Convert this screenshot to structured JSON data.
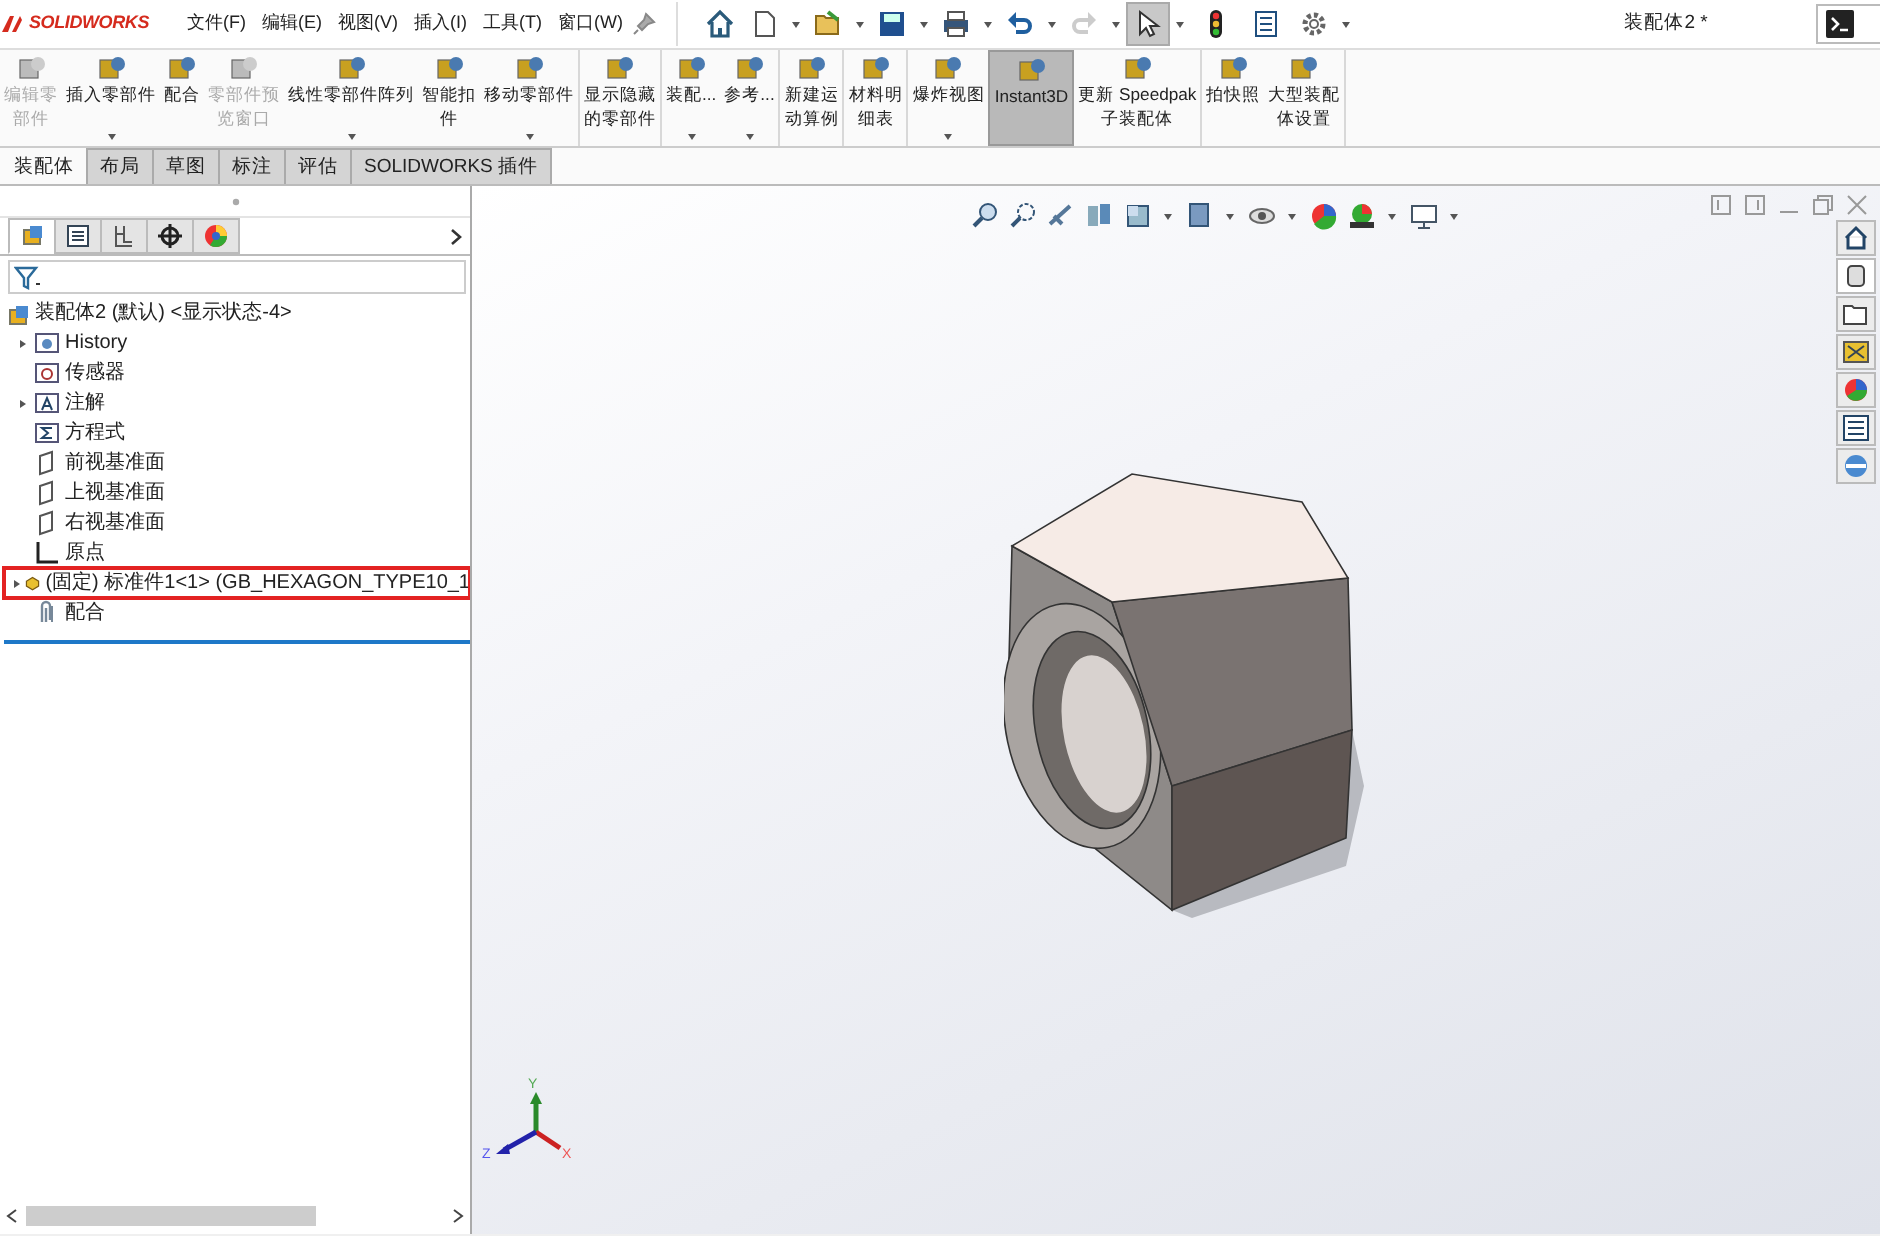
{
  "app": {
    "logo": "SOLIDWORKS"
  },
  "menu": [
    "文件(F)",
    "编辑(E)",
    "视图(V)",
    "插入(I)",
    "工具(T)",
    "窗口(W)"
  ],
  "window": {
    "title": "装配体2 *"
  },
  "ribbon": {
    "groups": [
      {
        "items": [
          {
            "lines": [
              "编辑零",
              "部件"
            ],
            "disabled": true,
            "dropdown": false,
            "selected": false
          },
          {
            "lines": [
              "插入零部件"
            ],
            "disabled": false,
            "dropdown": true,
            "selected": false
          },
          {
            "lines": [
              "配合"
            ],
            "disabled": false,
            "dropdown": false,
            "selected": false
          },
          {
            "lines": [
              "零部件预",
              "览窗口"
            ],
            "disabled": true,
            "dropdown": false,
            "selected": false
          },
          {
            "lines": [
              "线性零部件阵列"
            ],
            "disabled": false,
            "dropdown": true,
            "selected": false
          },
          {
            "lines": [
              "智能扣",
              "件"
            ],
            "disabled": false,
            "dropdown": false,
            "selected": false
          },
          {
            "lines": [
              "移动零部件"
            ],
            "disabled": false,
            "dropdown": true,
            "selected": false
          }
        ]
      },
      {
        "items": [
          {
            "lines": [
              "显示隐藏",
              "的零部件"
            ],
            "disabled": false,
            "dropdown": false,
            "selected": false
          }
        ]
      },
      {
        "items": [
          {
            "lines": [
              "装配..."
            ],
            "disabled": false,
            "dropdown": true,
            "selected": false
          },
          {
            "lines": [
              "参考..."
            ],
            "disabled": false,
            "dropdown": true,
            "selected": false
          }
        ]
      },
      {
        "items": [
          {
            "lines": [
              "新建运",
              "动算例"
            ],
            "disabled": false,
            "dropdown": false,
            "selected": false
          }
        ]
      },
      {
        "items": [
          {
            "lines": [
              "材料明",
              "细表"
            ],
            "disabled": false,
            "dropdown": false,
            "selected": false
          }
        ]
      },
      {
        "items": [
          {
            "lines": [
              "爆炸视图"
            ],
            "disabled": false,
            "dropdown": true,
            "selected": false
          },
          {
            "lines": [
              "Instant3D"
            ],
            "disabled": false,
            "dropdown": false,
            "selected": true
          },
          {
            "lines": [
              "更新 Speedpak",
              "子装配体"
            ],
            "disabled": false,
            "dropdown": false,
            "selected": false
          }
        ]
      },
      {
        "items": [
          {
            "lines": [
              "拍快照"
            ],
            "disabled": false,
            "dropdown": false,
            "selected": false
          },
          {
            "lines": [
              "大型装配",
              "体设置"
            ],
            "disabled": false,
            "dropdown": false,
            "selected": false
          }
        ]
      }
    ]
  },
  "tabs": [
    {
      "label": "装配体",
      "selected": true
    },
    {
      "label": "布局",
      "selected": false
    },
    {
      "label": "草图",
      "selected": false
    },
    {
      "label": "标注",
      "selected": false
    },
    {
      "label": "评估",
      "selected": false
    },
    {
      "label": "SOLIDWORKS 插件",
      "selected": false
    }
  ],
  "panel_tabs": [
    {
      "selected": true
    },
    {
      "selected": false
    },
    {
      "selected": false
    },
    {
      "selected": false
    },
    {
      "selected": false
    }
  ],
  "tree": {
    "label": "装配体2 (默认) <显示状态-4>",
    "children": [
      {
        "kind": "history",
        "label": "History",
        "expandable": true,
        "highlighted": false
      },
      {
        "kind": "sensor",
        "label": "传感器",
        "expandable": false,
        "highlighted": false
      },
      {
        "kind": "annotation",
        "label": "注解",
        "expandable": true,
        "highlighted": false
      },
      {
        "kind": "equation",
        "label": "方程式",
        "expandable": false,
        "highlighted": false
      },
      {
        "kind": "plane",
        "label": "前视基准面",
        "expandable": false,
        "highlighted": false
      },
      {
        "kind": "plane",
        "label": "上视基准面",
        "expandable": false,
        "highlighted": false
      },
      {
        "kind": "plane",
        "label": "右视基准面",
        "expandable": false,
        "highlighted": false
      },
      {
        "kind": "origin",
        "label": "原点",
        "expandable": false,
        "highlighted": false
      },
      {
        "kind": "part",
        "label": "(固定) 标准件1<1> (GB_HEXAGON_TYPE10_1",
        "expandable": true,
        "highlighted": true
      },
      {
        "kind": "mates",
        "label": "配合",
        "expandable": false,
        "highlighted": false
      }
    ]
  },
  "triad": {
    "y": "Y",
    "x": "X",
    "z": "Z"
  }
}
